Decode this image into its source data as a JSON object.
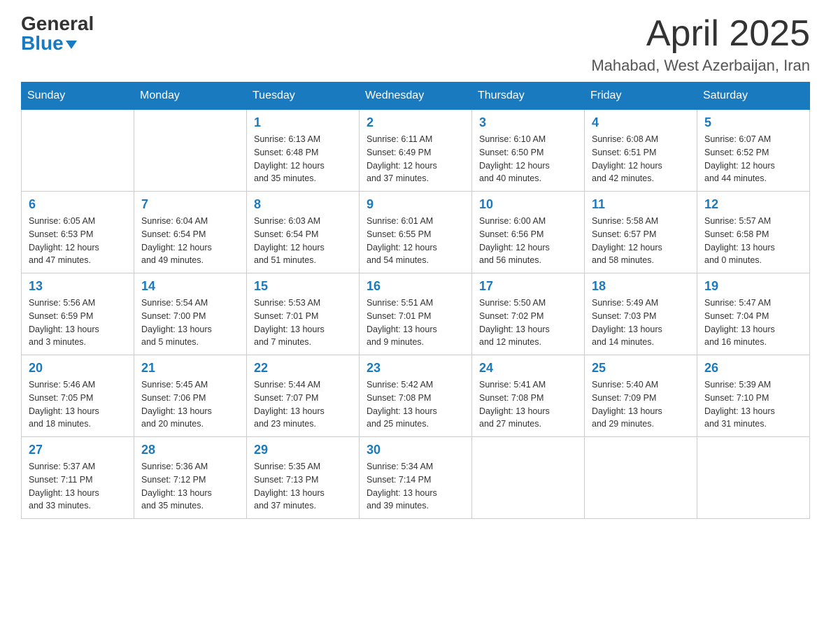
{
  "header": {
    "logo_general": "General",
    "logo_blue": "Blue",
    "month_title": "April 2025",
    "location": "Mahabad, West Azerbaijan, Iran"
  },
  "weekdays": [
    "Sunday",
    "Monday",
    "Tuesday",
    "Wednesday",
    "Thursday",
    "Friday",
    "Saturday"
  ],
  "weeks": [
    [
      {
        "day": "",
        "info": ""
      },
      {
        "day": "",
        "info": ""
      },
      {
        "day": "1",
        "info": "Sunrise: 6:13 AM\nSunset: 6:48 PM\nDaylight: 12 hours\nand 35 minutes."
      },
      {
        "day": "2",
        "info": "Sunrise: 6:11 AM\nSunset: 6:49 PM\nDaylight: 12 hours\nand 37 minutes."
      },
      {
        "day": "3",
        "info": "Sunrise: 6:10 AM\nSunset: 6:50 PM\nDaylight: 12 hours\nand 40 minutes."
      },
      {
        "day": "4",
        "info": "Sunrise: 6:08 AM\nSunset: 6:51 PM\nDaylight: 12 hours\nand 42 minutes."
      },
      {
        "day": "5",
        "info": "Sunrise: 6:07 AM\nSunset: 6:52 PM\nDaylight: 12 hours\nand 44 minutes."
      }
    ],
    [
      {
        "day": "6",
        "info": "Sunrise: 6:05 AM\nSunset: 6:53 PM\nDaylight: 12 hours\nand 47 minutes."
      },
      {
        "day": "7",
        "info": "Sunrise: 6:04 AM\nSunset: 6:54 PM\nDaylight: 12 hours\nand 49 minutes."
      },
      {
        "day": "8",
        "info": "Sunrise: 6:03 AM\nSunset: 6:54 PM\nDaylight: 12 hours\nand 51 minutes."
      },
      {
        "day": "9",
        "info": "Sunrise: 6:01 AM\nSunset: 6:55 PM\nDaylight: 12 hours\nand 54 minutes."
      },
      {
        "day": "10",
        "info": "Sunrise: 6:00 AM\nSunset: 6:56 PM\nDaylight: 12 hours\nand 56 minutes."
      },
      {
        "day": "11",
        "info": "Sunrise: 5:58 AM\nSunset: 6:57 PM\nDaylight: 12 hours\nand 58 minutes."
      },
      {
        "day": "12",
        "info": "Sunrise: 5:57 AM\nSunset: 6:58 PM\nDaylight: 13 hours\nand 0 minutes."
      }
    ],
    [
      {
        "day": "13",
        "info": "Sunrise: 5:56 AM\nSunset: 6:59 PM\nDaylight: 13 hours\nand 3 minutes."
      },
      {
        "day": "14",
        "info": "Sunrise: 5:54 AM\nSunset: 7:00 PM\nDaylight: 13 hours\nand 5 minutes."
      },
      {
        "day": "15",
        "info": "Sunrise: 5:53 AM\nSunset: 7:01 PM\nDaylight: 13 hours\nand 7 minutes."
      },
      {
        "day": "16",
        "info": "Sunrise: 5:51 AM\nSunset: 7:01 PM\nDaylight: 13 hours\nand 9 minutes."
      },
      {
        "day": "17",
        "info": "Sunrise: 5:50 AM\nSunset: 7:02 PM\nDaylight: 13 hours\nand 12 minutes."
      },
      {
        "day": "18",
        "info": "Sunrise: 5:49 AM\nSunset: 7:03 PM\nDaylight: 13 hours\nand 14 minutes."
      },
      {
        "day": "19",
        "info": "Sunrise: 5:47 AM\nSunset: 7:04 PM\nDaylight: 13 hours\nand 16 minutes."
      }
    ],
    [
      {
        "day": "20",
        "info": "Sunrise: 5:46 AM\nSunset: 7:05 PM\nDaylight: 13 hours\nand 18 minutes."
      },
      {
        "day": "21",
        "info": "Sunrise: 5:45 AM\nSunset: 7:06 PM\nDaylight: 13 hours\nand 20 minutes."
      },
      {
        "day": "22",
        "info": "Sunrise: 5:44 AM\nSunset: 7:07 PM\nDaylight: 13 hours\nand 23 minutes."
      },
      {
        "day": "23",
        "info": "Sunrise: 5:42 AM\nSunset: 7:08 PM\nDaylight: 13 hours\nand 25 minutes."
      },
      {
        "day": "24",
        "info": "Sunrise: 5:41 AM\nSunset: 7:08 PM\nDaylight: 13 hours\nand 27 minutes."
      },
      {
        "day": "25",
        "info": "Sunrise: 5:40 AM\nSunset: 7:09 PM\nDaylight: 13 hours\nand 29 minutes."
      },
      {
        "day": "26",
        "info": "Sunrise: 5:39 AM\nSunset: 7:10 PM\nDaylight: 13 hours\nand 31 minutes."
      }
    ],
    [
      {
        "day": "27",
        "info": "Sunrise: 5:37 AM\nSunset: 7:11 PM\nDaylight: 13 hours\nand 33 minutes."
      },
      {
        "day": "28",
        "info": "Sunrise: 5:36 AM\nSunset: 7:12 PM\nDaylight: 13 hours\nand 35 minutes."
      },
      {
        "day": "29",
        "info": "Sunrise: 5:35 AM\nSunset: 7:13 PM\nDaylight: 13 hours\nand 37 minutes."
      },
      {
        "day": "30",
        "info": "Sunrise: 5:34 AM\nSunset: 7:14 PM\nDaylight: 13 hours\nand 39 minutes."
      },
      {
        "day": "",
        "info": ""
      },
      {
        "day": "",
        "info": ""
      },
      {
        "day": "",
        "info": ""
      }
    ]
  ]
}
